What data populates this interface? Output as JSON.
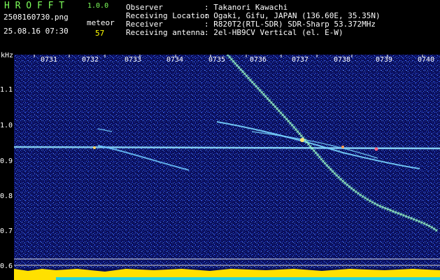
{
  "header": {
    "app_name": "H R O F F T",
    "version": "1.0.0",
    "filename": "2508160730.png",
    "datetime": "25.08.16 07:30",
    "mode_label": "meteor",
    "count": "57"
  },
  "info": [
    {
      "label": "Observer",
      "value": ": Takanori Kawachi"
    },
    {
      "label": "Receiving Location",
      "value": ": Ogaki, Gifu, JAPAN (136.60E, 35.35N)"
    },
    {
      "label": "Receiver",
      "value": ": R820T2(RTL-SDR) SDR-Sharp 53.372MHz"
    },
    {
      "label": "Receiving antenna",
      "value": ": 2el-HB9CV Vertical (el. E-W)"
    }
  ],
  "axis": {
    "y_unit": "kHz",
    "y_ticks": [
      "1.1",
      "1.0",
      "0.9",
      "0.8",
      "0.7",
      "0.6"
    ],
    "x_ticks": [
      "0731",
      "0732",
      "0733",
      "0734",
      "0735",
      "0736",
      "0737",
      "0738",
      "0739",
      "0740"
    ]
  },
  "colors": {
    "background": "#000000",
    "spectrogram_bg": "#0a0f5a",
    "trace": "#7fd0ff",
    "label_green": "#7dff5a",
    "label_yellow": "#ffff00"
  }
}
